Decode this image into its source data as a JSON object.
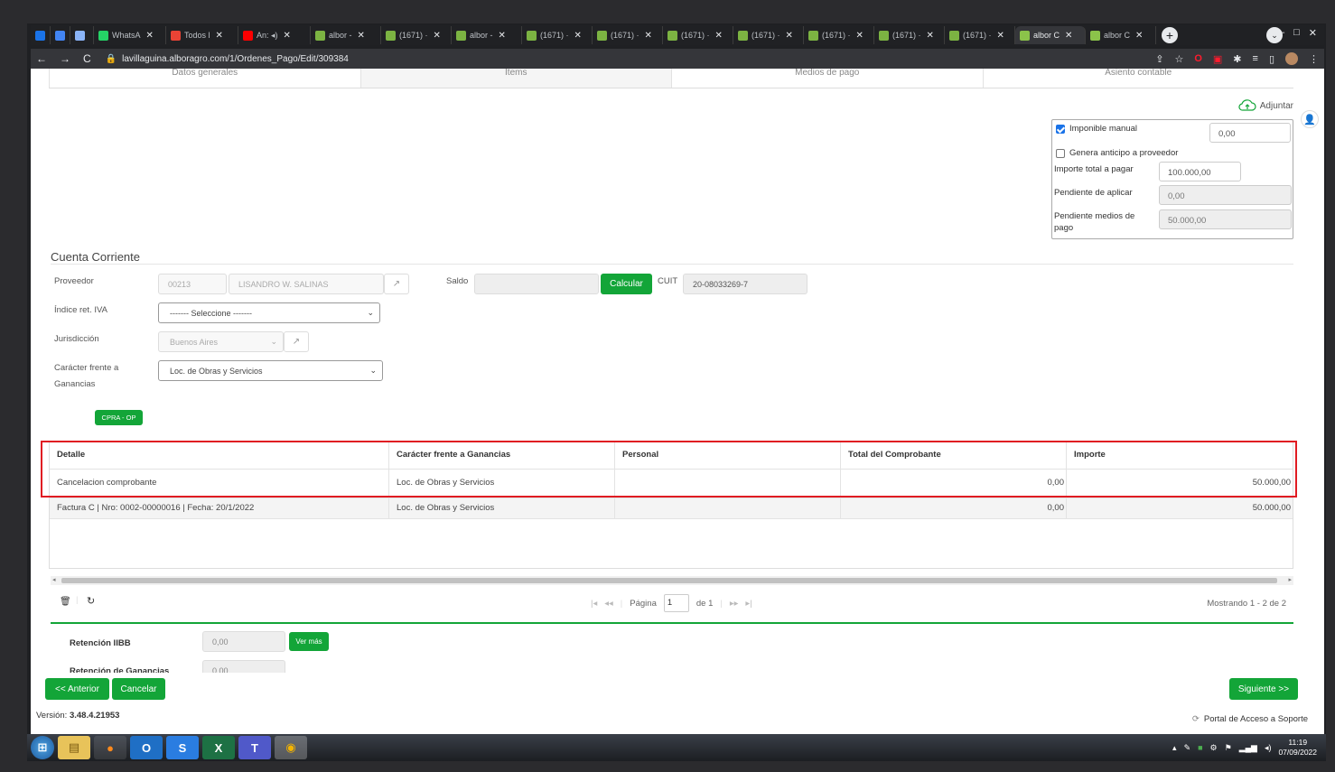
{
  "browser": {
    "tabs": [
      {
        "label": "",
        "color": "#1a73e8"
      },
      {
        "label": "",
        "color": "#4285f4"
      },
      {
        "label": "",
        "color": "#8ab4f8"
      },
      {
        "label": "WhatsA",
        "color": "#25d366"
      },
      {
        "label": "Todos l",
        "color": "#ea4335"
      },
      {
        "label": "An: ◂)",
        "color": "#ff0000"
      },
      {
        "label": "albor -",
        "color": "#7cb342"
      },
      {
        "label": "(1671) ·",
        "color": "#7cb342"
      },
      {
        "label": "albor -",
        "color": "#7cb342"
      },
      {
        "label": "(1671) ·",
        "color": "#7cb342"
      },
      {
        "label": "(1671) ·",
        "color": "#7cb342"
      },
      {
        "label": "(1671) ·",
        "color": "#7cb342"
      },
      {
        "label": "(1671) ·",
        "color": "#7cb342"
      },
      {
        "label": "(1671) ·",
        "color": "#7cb342"
      },
      {
        "label": "(1671) ·",
        "color": "#7cb342"
      },
      {
        "label": "(1671) ·",
        "color": "#7cb342"
      },
      {
        "label": "albor C",
        "color": "#8bc34a"
      },
      {
        "label": "albor C",
        "color": "#8bc34a"
      }
    ],
    "url": "lavillaguina.alboragro.com/1/Ordenes_Pago/Edit/309384"
  },
  "wizard_tabs": [
    "Datos generales",
    "Items",
    "Medios de pago",
    "Asiento contable"
  ],
  "adjuntar_label": "Adjuntar",
  "summary": {
    "imponible_manual_label": "Imponible manual",
    "imponible_manual_value": "0,00",
    "genera_anticipo_label": "Genera anticipo a proveedor",
    "importe_total_label": "Importe total a pagar",
    "importe_total_value": "100.000,00",
    "pendiente_aplicar_label": "Pendiente de aplicar",
    "pendiente_aplicar_value": "0,00",
    "pendiente_medios_label": "Pendiente medios de pago",
    "pendiente_medios_value": "50.000,00"
  },
  "cuenta_corriente": {
    "title": "Cuenta Corriente",
    "proveedor_label": "Proveedor",
    "proveedor_code": "00213",
    "proveedor_name": "LISANDRO W. SALINAS",
    "saldo_label": "Saldo",
    "saldo_value": "",
    "calcular_label": "Calcular",
    "cuit_label": "CUIT",
    "cuit_value": "20-08033269-7",
    "indice_label": "Índice ret. IVA",
    "indice_value": "------- Seleccione -------",
    "jurisdiccion_label": "Jurisdicción",
    "jurisdiccion_value": "Buenos Aires",
    "caracter_label_1": "Carácter frente a",
    "caracter_label_2": "Ganancias",
    "caracter_value": "Loc. de Obras y Servicios",
    "cpra_op_label": "CPRA - OP"
  },
  "grid": {
    "headers": [
      "Detalle",
      "Carácter frente a Ganancias",
      "Personal",
      "Total del Comprobante",
      "Importe"
    ],
    "rows": [
      [
        "Cancelacion comprobante",
        "Loc. de Obras y Servicios",
        "",
        "0,00",
        "50.000,00"
      ],
      [
        "Factura C | Nro: 0002-00000016 | Fecha: 20/1/2022",
        "Loc. de Obras y Servicios",
        "",
        "0,00",
        "50.000,00"
      ]
    ]
  },
  "pager": {
    "pagina_label": "Página",
    "page_value": "1",
    "de_label": "de 1",
    "mostrando": "Mostrando 1 - 2 de 2"
  },
  "retenciones": {
    "iibb_label": "Retención IIBB",
    "iibb_value": "0,00",
    "ver_mas_label": "Ver más",
    "ganancias_label": "Retención de Ganancias",
    "ganancias_value": "0,00"
  },
  "footer": {
    "anterior_label": "<< Anterior",
    "cancelar_label": "Cancelar",
    "siguiente_label": "Siguiente >>",
    "version_prefix": "Versión: ",
    "version_value": "3.48.4.21953",
    "portal_label": "Portal de Acceso a Soporte"
  },
  "taskbar": {
    "time": "11:19",
    "date": "07/09/2022"
  },
  "colors": {
    "accent_green": "#13a538",
    "highlight_red": "#e01b22"
  }
}
